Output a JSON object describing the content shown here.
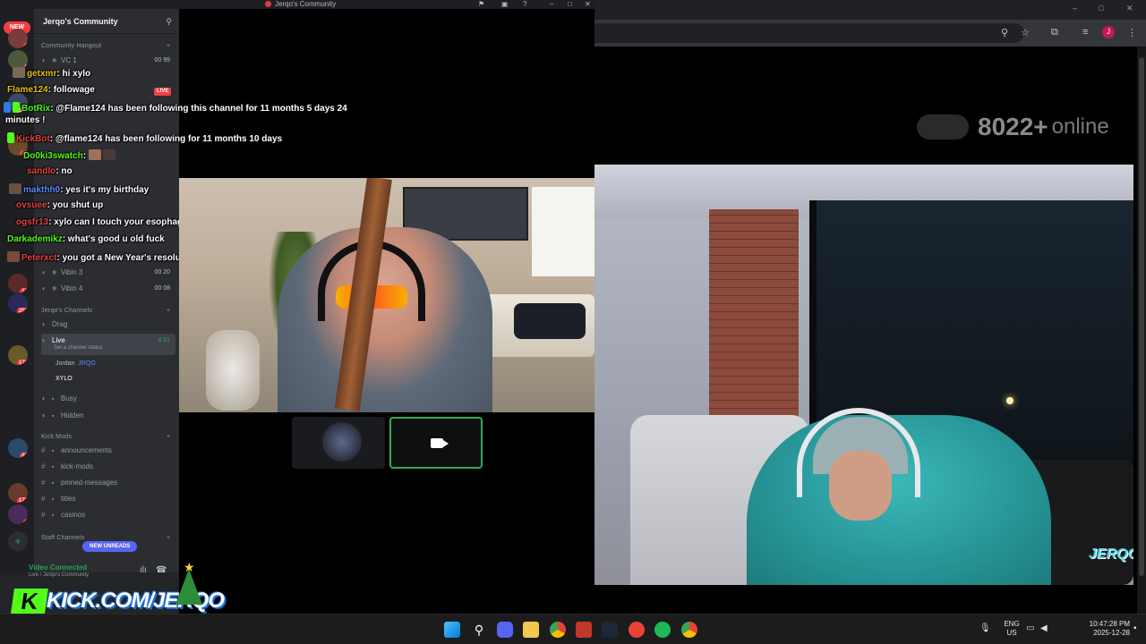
{
  "discord": {
    "window_title": "Jerqo's Community",
    "server_name": "Jerqo's Community",
    "new_badge": "NEW",
    "server_badges": [
      "1",
      "5",
      "147",
      "15",
      "13",
      "257",
      "171",
      "67",
      "171",
      "4"
    ],
    "categories": {
      "community_hangout": "Community Hangout",
      "jerqos_channels": "Jerqo's Channels",
      "kick_mods": "Kick Mods",
      "staff_channels": "Staff Channels"
    },
    "voice_channels": [
      {
        "name": "VC 1",
        "count": "00 99"
      },
      {
        "name": "Vibin 3",
        "count": "00 20"
      },
      {
        "name": "Vibin 4",
        "count": "00 08"
      }
    ],
    "drag_channel": "Drag",
    "live_channel": {
      "name": "Live",
      "time": "4:51",
      "status": "Set a channel status"
    },
    "live_users": [
      "Jordan",
      "JRQO",
      "XYLO"
    ],
    "other_voice": [
      "Busy",
      "Hidden"
    ],
    "kick_mod_channels": [
      "announcements",
      "kick-mods",
      "pinned-messages",
      "titles",
      "casinos"
    ],
    "new_unreads": "NEW UNREADS",
    "voice_status": "Video Connected",
    "voice_sub": "Live / Jerqo's Community",
    "live_badge": "LIVE"
  },
  "chat": [
    {
      "user": "getxmr",
      "text": ": hi xylo",
      "color": "#e8c020"
    },
    {
      "user": "Flame124",
      "text": ": followage",
      "color": "#e8c020"
    },
    {
      "user": "BotRix",
      "text": ": @Flame124 has been following this channel for 11 months 5 days 24",
      "color": "#53fc18"
    },
    {
      "user": "",
      "text": "minutes !",
      "color": "#ffffff"
    },
    {
      "user": "KickBot",
      "text": ": @flame124 has been following for 11 months 10 days",
      "color": "#e84040"
    },
    {
      "user": "Do0ki3swatch",
      "text": ":",
      "color": "#53fc18"
    },
    {
      "user": "sandlo",
      "text": ": no",
      "color": "#e84040"
    },
    {
      "user": "makthh0",
      "text": ": yes it's my birthday",
      "color": "#5b8cff"
    },
    {
      "user": "ovsuee",
      "text": ": you shut up",
      "color": "#e84040"
    },
    {
      "user": "ogsfr13",
      "text": ": xylo can I touch your esophagus?",
      "color": "#e84040"
    },
    {
      "user": "Darkademikz",
      "text": ": what's good u old fuck",
      "color": "#53fc18"
    },
    {
      "user": "Peterxct",
      "text": ": you got a New Year's resolution xylo?",
      "color": "#e84040"
    }
  ],
  "watermark": {
    "k": "K",
    "text": "KICK.COM/JERQO"
  },
  "browser": {
    "online_count": "8022+",
    "online_label": "online",
    "profile_initial": "J",
    "stream_logo": "JERQO"
  },
  "taskbar": {
    "lang_line1": "ENG",
    "lang_line2": "US",
    "time": "10:47:28 PM",
    "date": "2025-12-28"
  },
  "colors": {
    "accent_green": "#53fc18",
    "discord_blurple": "#5865f2",
    "live_red": "#f23f43"
  }
}
